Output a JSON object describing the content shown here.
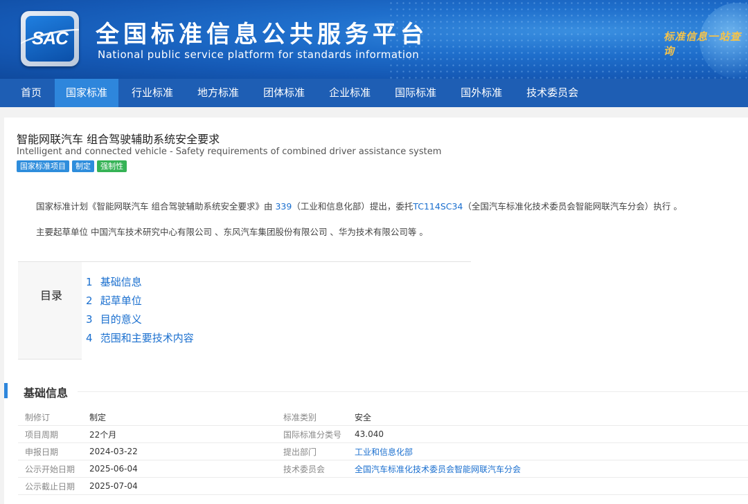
{
  "header": {
    "logo_text": "SAC",
    "title": "全国标准信息公共服务平台",
    "subtitle": "National public service platform  for standards information",
    "slogan": "标准信息一站查询"
  },
  "nav": [
    {
      "label": "首页",
      "active": false
    },
    {
      "label": "国家标准",
      "active": true
    },
    {
      "label": "行业标准",
      "active": false
    },
    {
      "label": "地方标准",
      "active": false
    },
    {
      "label": "团体标准",
      "active": false
    },
    {
      "label": "企业标准",
      "active": false
    },
    {
      "label": "国际标准",
      "active": false
    },
    {
      "label": "国外标准",
      "active": false
    },
    {
      "label": "技术委员会",
      "active": false
    }
  ],
  "standard": {
    "title_cn": "智能网联汽车 组合驾驶辅助系统安全要求",
    "title_en": "Intelligent and connected vehicle - Safety requirements of combined driver assistance system",
    "tags": [
      {
        "label": "国家标准项目",
        "color": "#2e8ddc"
      },
      {
        "label": "制定",
        "color": "#2e8ddc"
      },
      {
        "label": "强制性",
        "color": "#36b356"
      }
    ]
  },
  "summary": {
    "p1_a": "国家标准计划《智能网联汽车 组合驾驶辅助系统安全要求》由 ",
    "p1_link1": "339",
    "p1_b": "（工业和信息化部）提出，委托",
    "p1_link2": "TC114SC34",
    "p1_c": "（全国汽车标准化技术委员会智能网联汽车分会）执行 。",
    "p2": "主要起草单位 中国汽车技术研究中心有限公司 、东风汽车集团股份有限公司 、华为技术有限公司等 。"
  },
  "toc": {
    "label": "目录",
    "items": [
      {
        "num": "1",
        "label": "基础信息"
      },
      {
        "num": "2",
        "label": "起草单位"
      },
      {
        "num": "3",
        "label": "目的意义"
      },
      {
        "num": "4",
        "label": "范围和主要技术内容"
      }
    ]
  },
  "basic_info": {
    "heading": "基础信息",
    "rows": [
      {
        "k1": "制修订",
        "v1": "制定",
        "k2": "标准类别",
        "v2": "安全"
      },
      {
        "k1": "项目周期",
        "v1": "22个月",
        "k2": "国际标准分类号",
        "v2": "43.040"
      },
      {
        "k1": "申报日期",
        "v1": "2024-03-22",
        "k2": "提出部门",
        "v2": "工业和信息化部"
      },
      {
        "k1": "公示开始日期",
        "v1": "2025-06-04",
        "k2": "技术委员会",
        "v2": "全国汽车标准化技术委员会智能网联汽车分会"
      },
      {
        "k1": "公示截止日期",
        "v1": "2025-07-04",
        "k2": "",
        "v2": ""
      }
    ]
  }
}
